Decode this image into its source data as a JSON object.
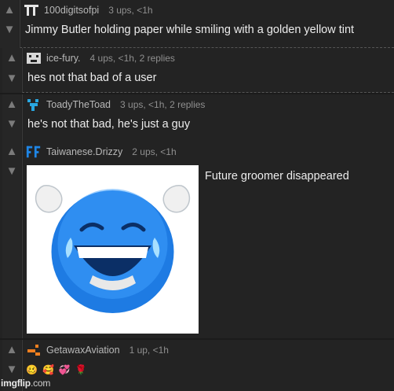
{
  "comments": [
    {
      "username": "100digitsofpi",
      "meta": "3 ups, <1h",
      "text": "Jimmy Butler holding paper while smiling with a golden yellow tint"
    },
    {
      "username": "ice-fury.",
      "meta": "4 ups, <1h, 2 replies",
      "text": "hes not that bad of a user"
    },
    {
      "username": "ToadyTheToad",
      "meta": "3 ups, <1h, 2 replies",
      "text": "he's not that bad, he's just a guy"
    },
    {
      "username": "Taiwanese.Drizzy",
      "meta": "2 ups, <1h",
      "text": "Future groomer disappeared",
      "image": "laughing-blue-emoji-image"
    },
    {
      "username": "GetawaxAviation",
      "meta": "1 up, <1h",
      "emojis": [
        "🥴",
        "🥰",
        "💞",
        "🌹"
      ]
    }
  ],
  "watermark": {
    "bold": "imgflip",
    "light": ".com"
  },
  "icons": {
    "upvote": "upvote-arrow-icon",
    "downvote": "downvote-arrow-icon"
  }
}
